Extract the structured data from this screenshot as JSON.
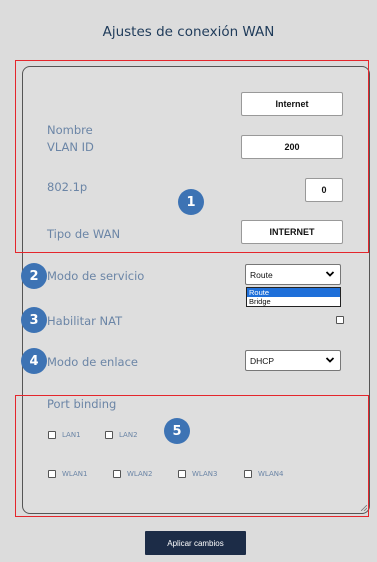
{
  "title": "Ajustes de conexión WAN",
  "fields": {
    "nombre": {
      "label": "Nombre",
      "value": "Internet"
    },
    "vlan": {
      "label": "VLAN ID",
      "value": "200"
    },
    "p8021": {
      "label": "802.1p",
      "value": "0"
    },
    "tipo_wan": {
      "label": "Tipo de WAN",
      "value": "INTERNET"
    }
  },
  "modo_servicio": {
    "label": "Modo de servicio",
    "selected": "Route",
    "options": [
      "Route",
      "Bridge"
    ],
    "highlighted": "Route"
  },
  "nat": {
    "label": "Habilitar NAT",
    "checked": false
  },
  "modo_enlace": {
    "label": "Modo de enlace",
    "selected": "DHCP"
  },
  "port_binding": {
    "label": "Port binding",
    "ports_row1": [
      "LAN1",
      "LAN2"
    ],
    "ports_row2": [
      "WLAN1",
      "WLAN2",
      "WLAN3",
      "WLAN4"
    ]
  },
  "badges": [
    "1",
    "2",
    "3",
    "4",
    "5"
  ],
  "apply_label": "Aplicar cambios",
  "colors": {
    "accent": "#3d73b4",
    "highlight": "#e4262c",
    "button": "#1c2c47",
    "label": "#6b85a6"
  }
}
